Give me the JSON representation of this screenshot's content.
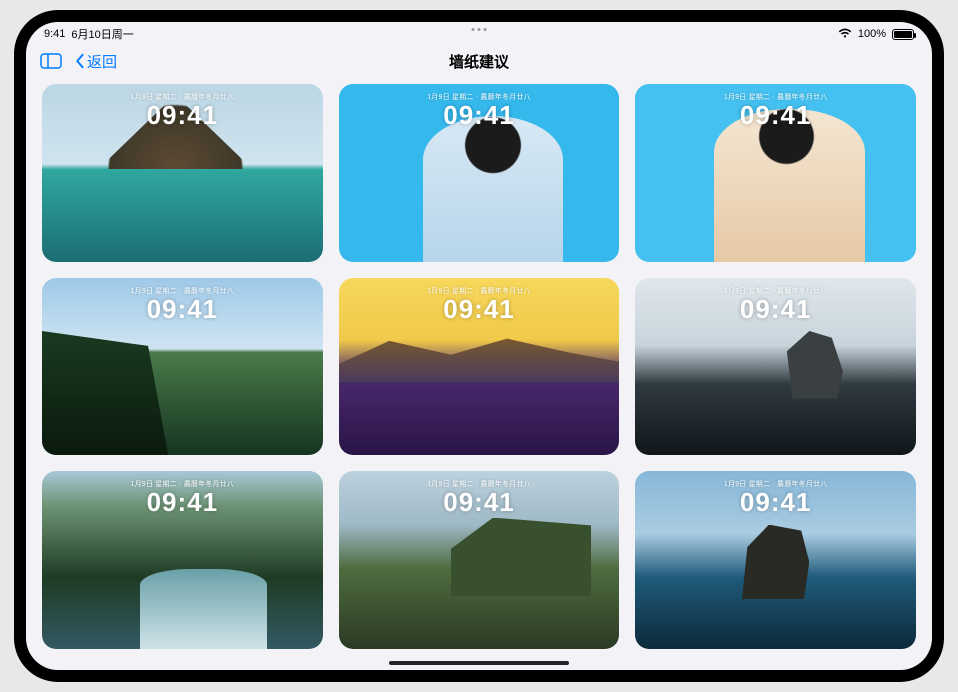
{
  "statusbar": {
    "time": "9:41",
    "date": "6月10日周一",
    "battery_pct": "100%"
  },
  "nav": {
    "back_label": "返回",
    "title": "墙纸建议"
  },
  "tile_text": {
    "date": "1月9日 星期二 · 農曆年冬月廿八",
    "time": "09:41"
  },
  "tiles": [
    {
      "name": "wallpaper-volcano-lagoon",
      "scene": "volcano"
    },
    {
      "name": "wallpaper-portrait-blue-1",
      "scene": "portrait1"
    },
    {
      "name": "wallpaper-portrait-blue-2",
      "scene": "portrait2"
    },
    {
      "name": "wallpaper-green-cliff",
      "scene": "cliff-green"
    },
    {
      "name": "wallpaper-beach-duotone",
      "scene": "beach-duotone"
    },
    {
      "name": "wallpaper-sea-stack-bw",
      "scene": "seastack"
    },
    {
      "name": "wallpaper-jungle-river",
      "scene": "river"
    },
    {
      "name": "wallpaper-highlands",
      "scene": "highlands"
    },
    {
      "name": "wallpaper-sea-rock",
      "scene": "searock"
    }
  ]
}
